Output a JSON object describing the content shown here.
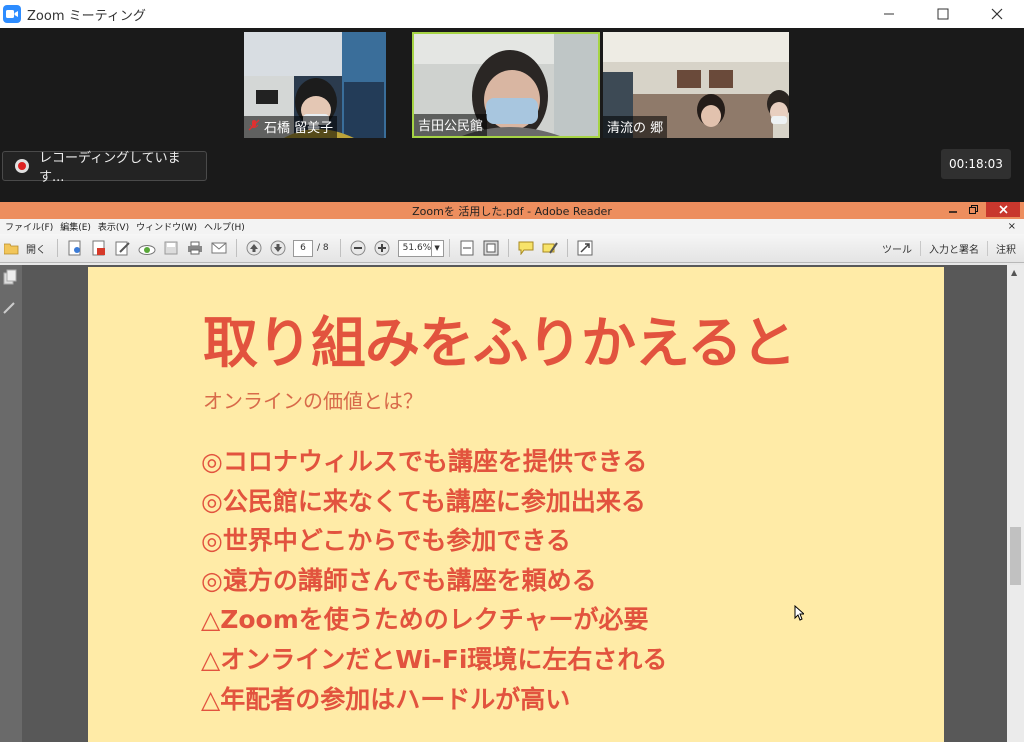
{
  "zoom": {
    "title": "Zoom ミーティング",
    "participants": [
      {
        "name": "石橋 留美子",
        "muted": true
      },
      {
        "name": "吉田公民館",
        "muted": false,
        "active_speaker": true
      },
      {
        "name": "清流の 郷",
        "muted": false
      }
    ],
    "recording_label": "レコーディングしています...",
    "timer": "00:18:03",
    "colors": {
      "zoom_blue": "#2d8cff",
      "active_border": "#a6d445",
      "recording_red": "#dd2222"
    }
  },
  "reader": {
    "title": "Zoomを 活用した.pdf - Adobe Reader",
    "menu": [
      "ファイル(F)",
      "編集(E)",
      "表示(V)",
      "ウィンドウ(W)",
      "ヘルプ(H)"
    ],
    "toolbar": {
      "open_label": "開く",
      "page_current": "6",
      "page_total": "/ 8",
      "zoom_level": "51.6%",
      "right_items": [
        "ツール",
        "入力と署名",
        "注釈"
      ]
    },
    "colors": {
      "titlebar": "#ed8e5e",
      "close_button": "#c8372d"
    }
  },
  "slide": {
    "title": "取り組みをふりかえると",
    "subtitle": "オンラインの価値とは？",
    "bullets": [
      "◎コロナウィルスでも講座を提供できる",
      "◎公民館に来なくても講座に参加出来る",
      "◎世界中どこからでも参加できる",
      "◎遠方の講師さんでも講座を頼める",
      "△Zoomを使うためのレクチャーが必要",
      "△オンラインだとWi-Fi環境に左右される",
      "△年配者の参加はハードルが高い"
    ],
    "colors": {
      "background": "#ffeba7",
      "text": "#e2533e"
    }
  }
}
